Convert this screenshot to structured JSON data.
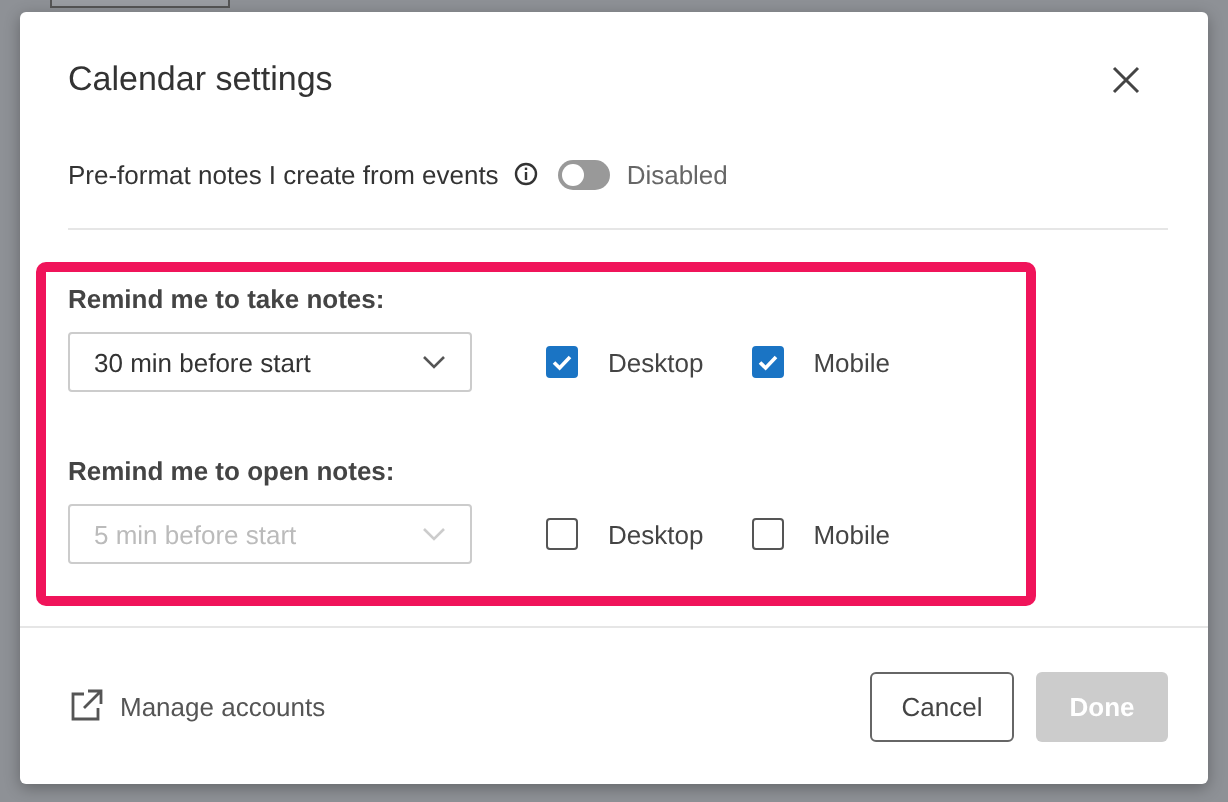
{
  "dialog": {
    "title": "Calendar settings",
    "preformat": {
      "label": "Pre-format notes I create from events",
      "on": false,
      "status": "Disabled"
    },
    "reminders": [
      {
        "label": "Remind me to take notes:",
        "select": {
          "value": "30 min before start",
          "disabled": false
        },
        "options": [
          {
            "label": "Desktop",
            "checked": true
          },
          {
            "label": "Mobile",
            "checked": true
          }
        ]
      },
      {
        "label": "Remind me to open notes:",
        "select": {
          "value": "5 min before start",
          "disabled": true
        },
        "options": [
          {
            "label": "Desktop",
            "checked": false
          },
          {
            "label": "Mobile",
            "checked": false
          }
        ]
      }
    ],
    "link": "Manage accounts",
    "buttons": [
      {
        "label": "Cancel",
        "kind": "secondary",
        "disabled": false
      },
      {
        "label": "Done",
        "kind": "primary",
        "disabled": true
      }
    ]
  }
}
